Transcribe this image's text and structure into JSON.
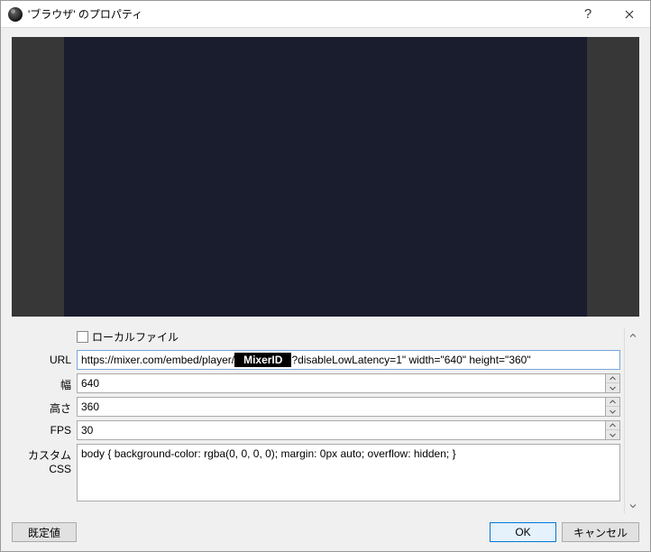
{
  "titlebar": {
    "title": "'ブラウザ' のプロパティ"
  },
  "form": {
    "local_file": {
      "label": "ローカルファイル",
      "checked": false
    },
    "url": {
      "label": "URL",
      "prefix": "https://mixer.com/embed/player/",
      "redacted": "MixerID",
      "suffix": "?disableLowLatency=1\" width=\"640\" height=\"360\""
    },
    "width": {
      "label": "幅",
      "value": "640"
    },
    "height": {
      "label": "高さ",
      "value": "360"
    },
    "fps": {
      "label": "FPS",
      "value": "30"
    },
    "css": {
      "label": "カスタム CSS",
      "value": "body { background-color: rgba(0, 0, 0, 0); margin: 0px auto; overflow: hidden; }"
    }
  },
  "buttons": {
    "defaults": "既定値",
    "ok": "OK",
    "cancel": "キャンセル"
  }
}
